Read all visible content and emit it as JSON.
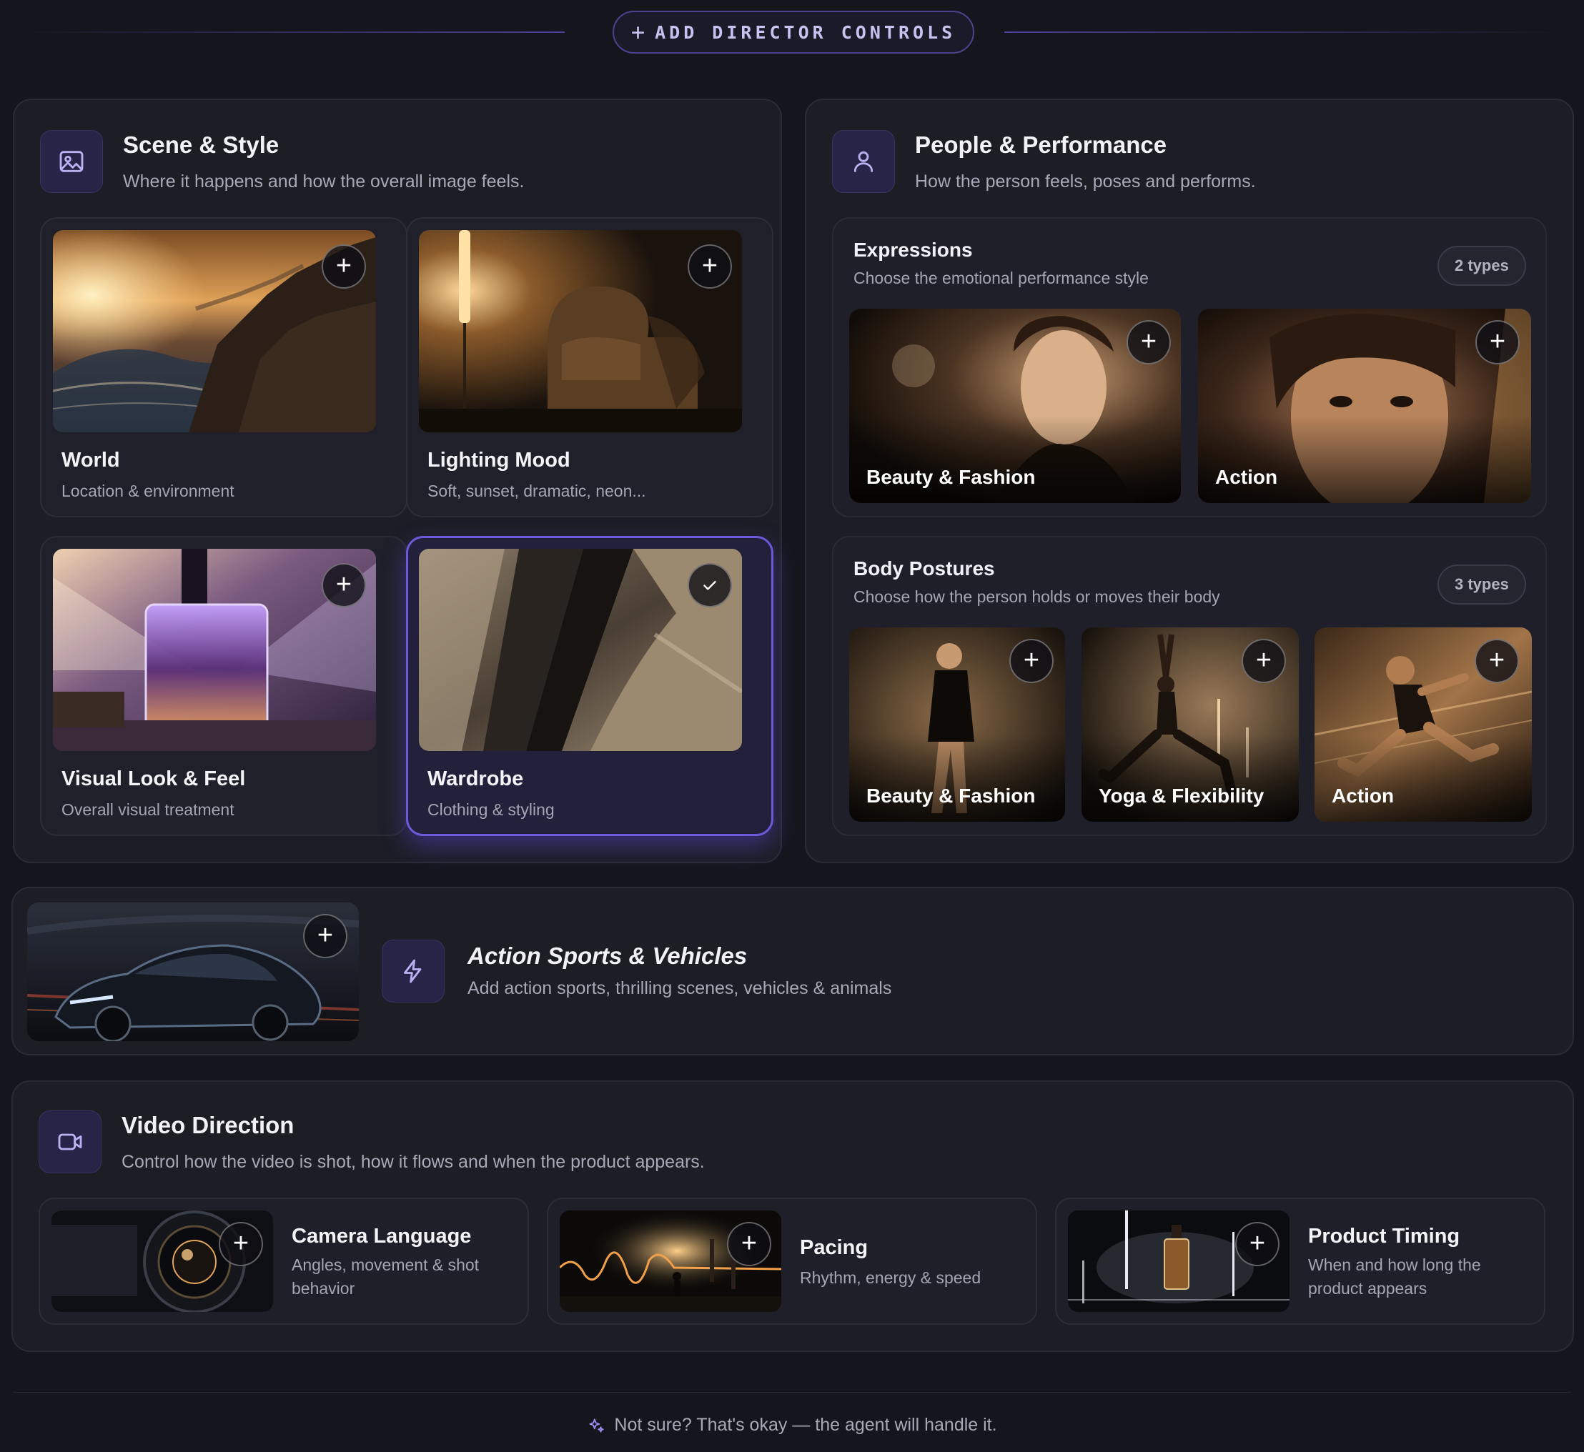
{
  "top_button": {
    "plus": "+",
    "label": "ADD DIRECTOR CONTROLS"
  },
  "scene": {
    "title": "Scene & Style",
    "subtitle": "Where it happens and how the overall image feels.",
    "icon": "image-icon",
    "cards": [
      {
        "title": "World",
        "subtitle": "Location & environment",
        "state": "add"
      },
      {
        "title": "Lighting Mood",
        "subtitle": "Soft, sunset, dramatic, neon...",
        "state": "add"
      },
      {
        "title": "Visual Look & Feel",
        "subtitle": "Overall visual treatment",
        "state": "add"
      },
      {
        "title": "Wardrobe",
        "subtitle": "Clothing & styling",
        "state": "selected"
      }
    ]
  },
  "people": {
    "title": "People & Performance",
    "subtitle": "How the person feels, poses and performs.",
    "icon": "user-icon",
    "expressions": {
      "title": "Expressions",
      "subtitle": "Choose the emotional performance style",
      "badge": "2 types",
      "items": [
        "Beauty & Fashion",
        "Action"
      ]
    },
    "postures": {
      "title": "Body Postures",
      "subtitle": "Choose how the person holds or moves their body",
      "badge": "3 types",
      "items": [
        "Beauty & Fashion",
        "Yoga & Flexibility",
        "Action"
      ]
    }
  },
  "action": {
    "title": "Action Sports & Vehicles",
    "subtitle": "Add action sports, thrilling scenes, vehicles & animals",
    "icon": "bolt-icon"
  },
  "video": {
    "title": "Video Direction",
    "subtitle": "Control how the video is shot, how it flows and when the product appears.",
    "icon": "video-camera-icon",
    "cards": [
      {
        "title": "Camera Language",
        "subtitle": "Angles, movement & shot behavior"
      },
      {
        "title": "Pacing",
        "subtitle": "Rhythm, energy & speed"
      },
      {
        "title": "Product Timing",
        "subtitle": "When and how long the product appears"
      }
    ]
  },
  "footer": {
    "text": "Not sure? That's okay — the agent will handle it.",
    "icon": "sparkles-icon"
  },
  "colors": {
    "background": "#15161d",
    "accent": "#6a5ad8",
    "panel": "#1c1d25"
  }
}
